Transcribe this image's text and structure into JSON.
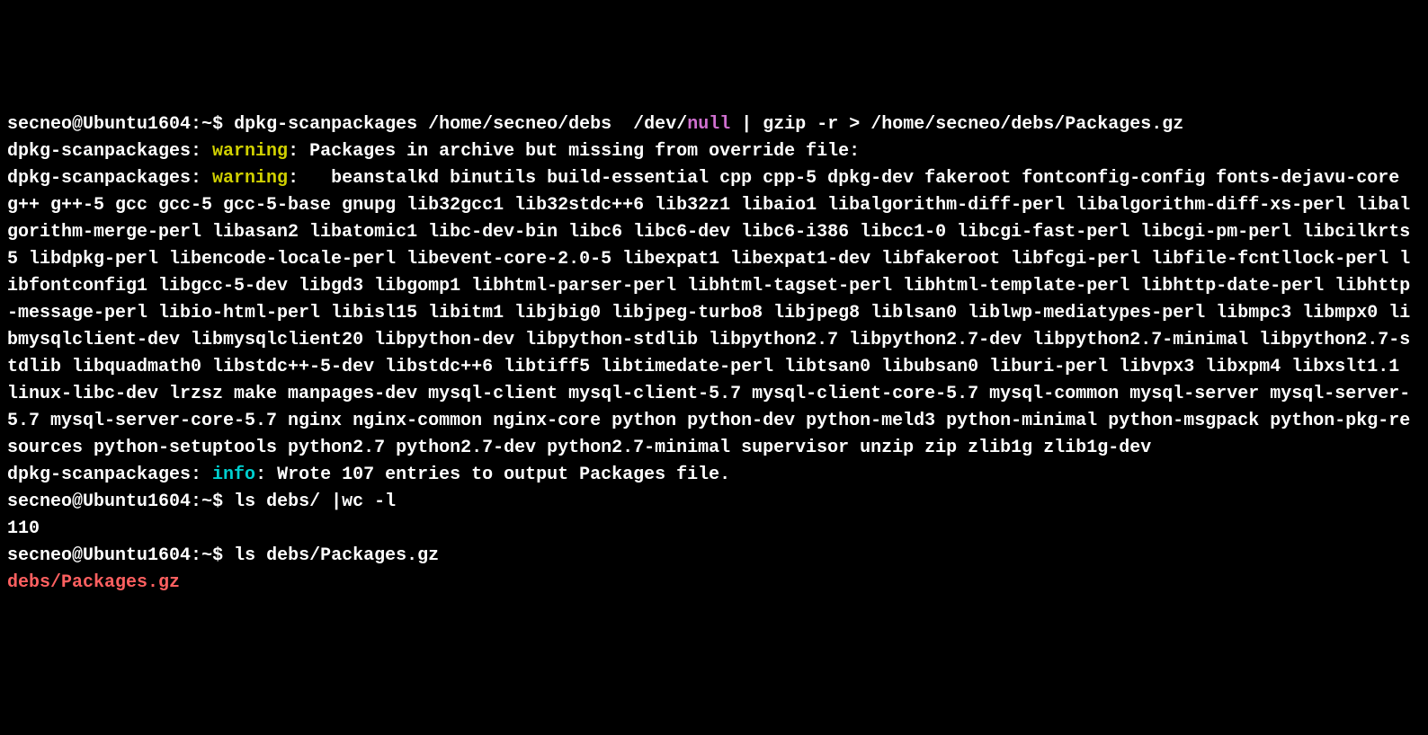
{
  "prompt": {
    "user_host": "secneo@Ubuntu1604",
    "path": "~",
    "symbol": "$"
  },
  "line1": {
    "cmd_part1": "dpkg-scanpackages /home/secneo/debs  /dev/",
    "null_kw": "null",
    "cmd_part2": " | gzip -r > /home/secneo/debs/Packages.gz"
  },
  "line2": {
    "prefix": "dpkg-scanpackages: ",
    "warning": "warning",
    "text": ": Packages in archive but missing from override file:"
  },
  "line3": {
    "prefix": "dpkg-scanpackages: ",
    "warning": "warning",
    "text": ":   beanstalkd binutils build-essential cpp cpp-5 dpkg-dev fakeroot fontconfig-config fonts-dejavu-core g++ g++-5 gcc gcc-5 gcc-5-base gnupg lib32gcc1 lib32stdc++6 lib32z1 libaio1 libalgorithm-diff-perl libalgorithm-diff-xs-perl libalgorithm-merge-perl libasan2 libatomic1 libc-dev-bin libc6 libc6-dev libc6-i386 libcc1-0 libcgi-fast-perl libcgi-pm-perl libcilkrts5 libdpkg-perl libencode-locale-perl libevent-core-2.0-5 libexpat1 libexpat1-dev libfakeroot libfcgi-perl libfile-fcntllock-perl libfontconfig1 libgcc-5-dev libgd3 libgomp1 libhtml-parser-perl libhtml-tagset-perl libhtml-template-perl libhttp-date-perl libhttp-message-perl libio-html-perl libisl15 libitm1 libjbig0 libjpeg-turbo8 libjpeg8 liblsan0 liblwp-mediatypes-perl libmpc3 libmpx0 libmysqlclient-dev libmysqlclient20 libpython-dev libpython-stdlib libpython2.7 libpython2.7-dev libpython2.7-minimal libpython2.7-stdlib libquadmath0 libstdc++-5-dev libstdc++6 libtiff5 libtimedate-perl libtsan0 libubsan0 liburi-perl libvpx3 libxpm4 libxslt1.1 linux-libc-dev lrzsz make manpages-dev mysql-client mysql-client-5.7 mysql-client-core-5.7 mysql-common mysql-server mysql-server-5.7 mysql-server-core-5.7 nginx nginx-common nginx-core python python-dev python-meld3 python-minimal python-msgpack python-pkg-resources python-setuptools python2.7 python2.7-dev python2.7-minimal supervisor unzip zip zlib1g zlib1g-dev"
  },
  "line4": {
    "prefix": "dpkg-scanpackages: ",
    "info": "info",
    "text": ": Wrote 107 entries to output Packages file."
  },
  "line5": {
    "cmd": "ls debs/ |wc -l"
  },
  "line6": {
    "output": "110"
  },
  "line7": {
    "cmd": "ls debs/Packages.gz"
  },
  "line8": {
    "output": "debs/Packages.gz"
  }
}
